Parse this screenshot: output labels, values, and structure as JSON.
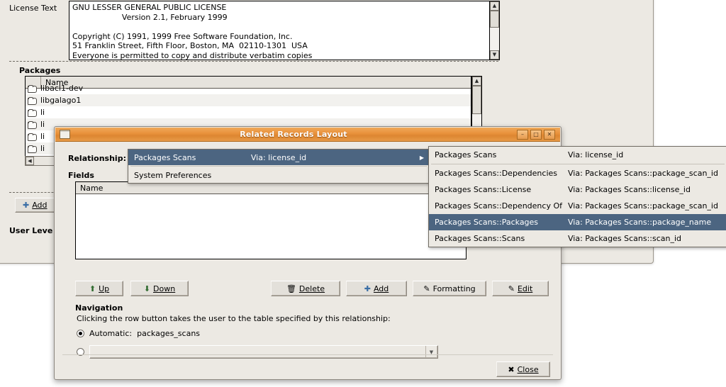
{
  "background_window": {
    "license": {
      "label": "License Text",
      "text": "GNU LESSER GENERAL PUBLIC LICENSE\n                    Version 2.1, February 1999\n\nCopyright (C) 1991, 1999 Free Software Foundation, Inc.\n51 Franklin Street, Fifth Floor, Boston, MA  02110-1301  USA\nEveryone is permitted to copy and distribute verbatim copies"
    },
    "packages": {
      "group_title": "Packages",
      "column_header": "Name",
      "rows": [
        {
          "name": "libacl1-dev"
        },
        {
          "name": "libgalago1"
        },
        {
          "name": "li"
        },
        {
          "name": "li"
        },
        {
          "name": "li"
        },
        {
          "name": "li"
        }
      ]
    },
    "add_button": "Add",
    "user_level_label": "User Leve"
  },
  "dialog": {
    "title": "Related Records Layout",
    "window_buttons": {
      "minimize": "–",
      "maximize": "□",
      "close": "✕"
    },
    "relationship_label": "Relationship:",
    "fields_label": "Fields",
    "fields_column_header": "Name",
    "fields_rows": [],
    "buttons": [
      {
        "label": "Up",
        "accesskey": "U",
        "icon": "arrow-up-icon"
      },
      {
        "label": "Down",
        "accesskey": "D",
        "icon": "arrow-down-icon"
      },
      {
        "label": "Delete",
        "accesskey": "D",
        "icon": "trash-icon"
      },
      {
        "label": "Add",
        "accesskey": "A",
        "icon": "plus-icon"
      },
      {
        "label": "Formatting",
        "accesskey": "F",
        "icon": "edit-pencil-icon"
      },
      {
        "label": "Edit",
        "accesskey": "E",
        "icon": "edit-pencil-icon"
      }
    ],
    "navigation": {
      "title": "Navigation",
      "description": "Clicking the row button takes the user to the table specified by this relationship:",
      "option_automatic_label": "Automatic:",
      "option_automatic_value": "packages_scans",
      "option_automatic_selected": true,
      "option_custom_selected": false,
      "custom_combo_value": "",
      "custom_combo_arrow": "▼"
    },
    "close_button": {
      "label": "Close",
      "accesskey": "C",
      "icon": "x-icon"
    }
  },
  "menu_primary": {
    "items": [
      {
        "name": "Packages Scans",
        "via": "Via: license_id",
        "selected": true,
        "submenu": true,
        "arrow": "▶"
      },
      {
        "separator": true
      },
      {
        "name": "System Preferences",
        "via": "",
        "selected": false,
        "submenu": false
      }
    ]
  },
  "menu_submenu": {
    "items": [
      {
        "name": "Packages Scans",
        "via": "Via: license_id",
        "selected": false,
        "centered": true
      },
      {
        "separator": true
      },
      {
        "name": "Packages Scans::Dependencies",
        "via": "Via: Packages Scans::package_scan_id",
        "selected": false
      },
      {
        "name": "Packages Scans::License",
        "via": "Via: Packages Scans::license_id",
        "selected": false
      },
      {
        "name": "Packages Scans::Dependency Of",
        "via": "Via: Packages Scans::package_scan_id",
        "selected": false
      },
      {
        "name": "Packages Scans::Packages",
        "via": "Via: Packages Scans::package_name",
        "selected": true
      },
      {
        "name": "Packages Scans::Scans",
        "via": "Via: Packages Scans::scan_id",
        "selected": false
      }
    ]
  },
  "colors": {
    "titlebar_orange": "#e8903a",
    "menu_highlight": "#4c6581",
    "window_bg": "#ece9e3",
    "field_white": "#ffffff"
  }
}
